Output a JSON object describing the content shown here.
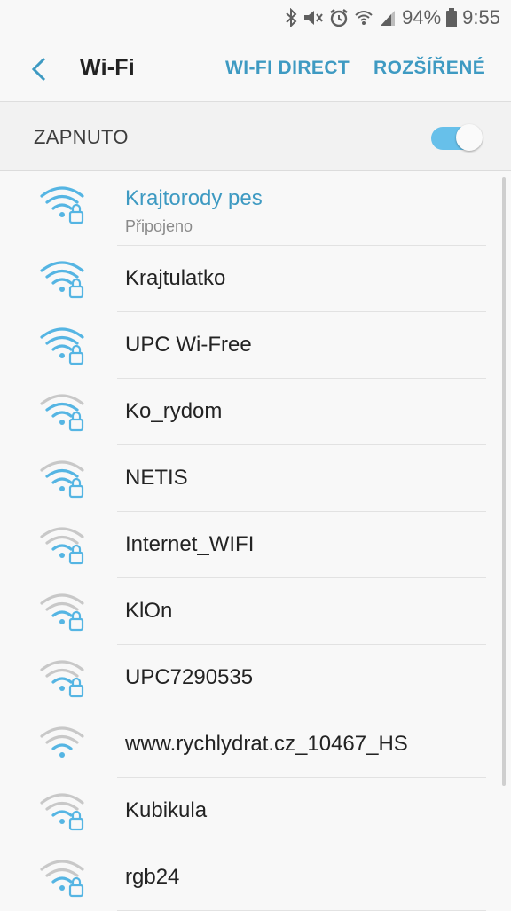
{
  "status_bar": {
    "battery": "94%",
    "time": "9:55",
    "icons": [
      "bluetooth-icon",
      "mute-icon",
      "alarm-icon",
      "wifi-status-icon",
      "cell-signal-icon",
      "battery-icon"
    ]
  },
  "app_bar": {
    "title": "Wi-Fi",
    "back_icon": "back-arrow-icon",
    "actions": {
      "wifi_direct": "WI-FI DIRECT",
      "advanced": "ROZŠÍŘENÉ"
    }
  },
  "wifi_toggle": {
    "label": "ZAPNUTO",
    "state": "on"
  },
  "colors": {
    "accent": "#3e9ac2",
    "strong_signal": "#55b5e3",
    "weak_signal": "#c8c8c8",
    "toggle_track": "#67c0ea"
  },
  "networks": [
    {
      "ssid": "Krajtorody pes",
      "status": "Připojeno",
      "signal_bars": 3,
      "secured": true
    },
    {
      "ssid": "Krajtulatko",
      "signal_bars": 3,
      "secured": true
    },
    {
      "ssid": "UPC Wi-Free",
      "signal_bars": 3,
      "secured": true
    },
    {
      "ssid": "Ko_rydom",
      "signal_bars": 2,
      "secured": true
    },
    {
      "ssid": "NETIS",
      "signal_bars": 2,
      "secured": true
    },
    {
      "ssid": "Internet_WIFI",
      "signal_bars": 1,
      "secured": true
    },
    {
      "ssid": "KlOn",
      "signal_bars": 1,
      "secured": true
    },
    {
      "ssid": "UPC7290535",
      "signal_bars": 1,
      "secured": true
    },
    {
      "ssid": "www.rychlydrat.cz_10467_HS",
      "signal_bars": 1,
      "secured": false
    },
    {
      "ssid": "Kubikula",
      "signal_bars": 1,
      "secured": true
    },
    {
      "ssid": "rgb24",
      "signal_bars": 1,
      "secured": true
    }
  ]
}
